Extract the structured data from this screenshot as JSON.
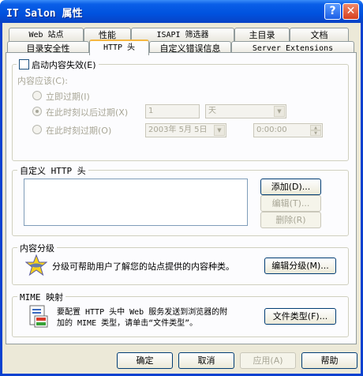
{
  "window": {
    "title": "IT Salon 属性",
    "help_glyph": "?",
    "close_glyph": "✕"
  },
  "tabs_row1": [
    "Web 站点",
    "性能",
    "ISAPI 筛选器",
    "主目录",
    "文档"
  ],
  "tabs_row2": [
    "目录安全性",
    "HTTP 头",
    "自定义错误信息",
    "Server Extensions"
  ],
  "active_tab": "HTTP 头",
  "expiry": {
    "checkbox_label": "启动内容失效(E)",
    "checked": false,
    "content_should": "内容应该(C):",
    "opt_now": "立即过期(I)",
    "opt_after": "在此时刻以后过期(X)",
    "opt_at": "在此时刻过期(O)",
    "after_value": "1",
    "after_unit": "天",
    "date_value": "2003年 5月 5日",
    "time_value": "0:00:00"
  },
  "custom_headers": {
    "title": "自定义 HTTP 头",
    "add_label": "添加(D)...",
    "edit_label": "编辑(T)...",
    "delete_label": "删除(R)"
  },
  "rating": {
    "title": "内容分级",
    "description": "分级可帮助用户了解您的站点提供的内容种类。",
    "button_label": "编辑分级(M)..."
  },
  "mime": {
    "title": "MIME 映射",
    "description_line1": "要配置 HTTP 头中 Web 服务发送到浏览器的附",
    "description_line2": "加的 MIME 类型，请单击“文件类型”。",
    "button_label": "文件类型(F)..."
  },
  "footer": {
    "ok": "确定",
    "cancel": "取消",
    "apply": "应用(A)",
    "help": "帮助"
  }
}
